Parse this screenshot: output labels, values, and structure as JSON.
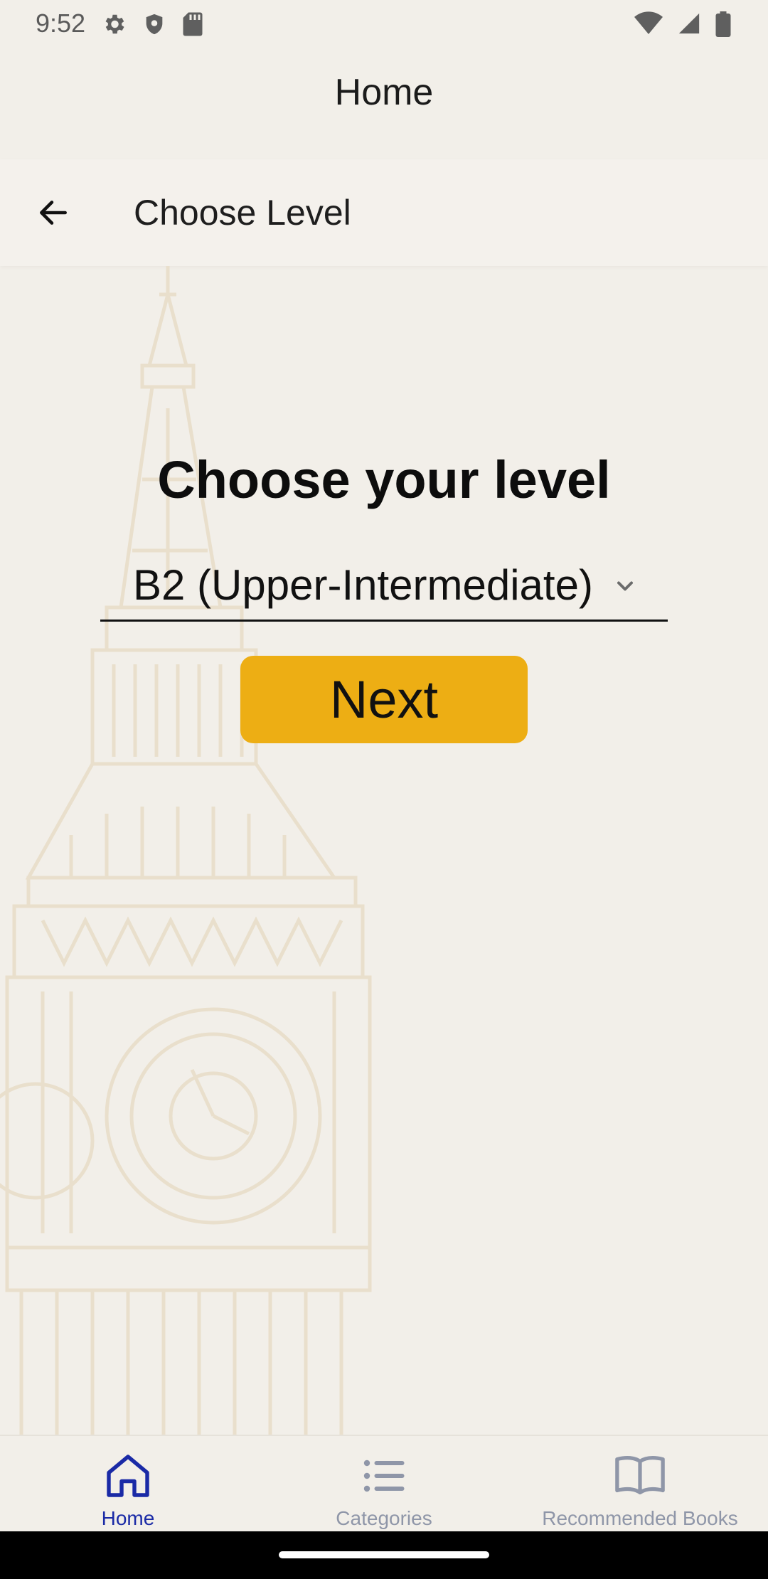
{
  "status_bar": {
    "time": "9:52",
    "icons_left": [
      "settings-gear-icon",
      "shield-icon",
      "sd-card-icon"
    ],
    "icons_right": [
      "wifi-icon",
      "signal-icon",
      "battery-icon"
    ]
  },
  "top_bar": {
    "title": "Home"
  },
  "app_bar": {
    "back_icon": "arrow-back-icon",
    "title": "Choose Level"
  },
  "main": {
    "heading": "Choose your level",
    "level_select": {
      "selected": "B2 (Upper-Intermediate)",
      "icon": "chevron-down-icon"
    },
    "next_button": {
      "label": "Next",
      "color": "#edae14"
    }
  },
  "bottom_nav": {
    "active_color": "#1a2aa6",
    "inactive_color": "#8f96a8",
    "items": [
      {
        "label": "Home",
        "icon": "home-icon",
        "active": true
      },
      {
        "label": "Categories",
        "icon": "list-icon",
        "active": false
      },
      {
        "label": "Recommended Books",
        "icon": "book-icon",
        "active": false
      }
    ]
  },
  "colors": {
    "background": "#f2efe9",
    "tower_sketch": "#e9dfcc"
  }
}
